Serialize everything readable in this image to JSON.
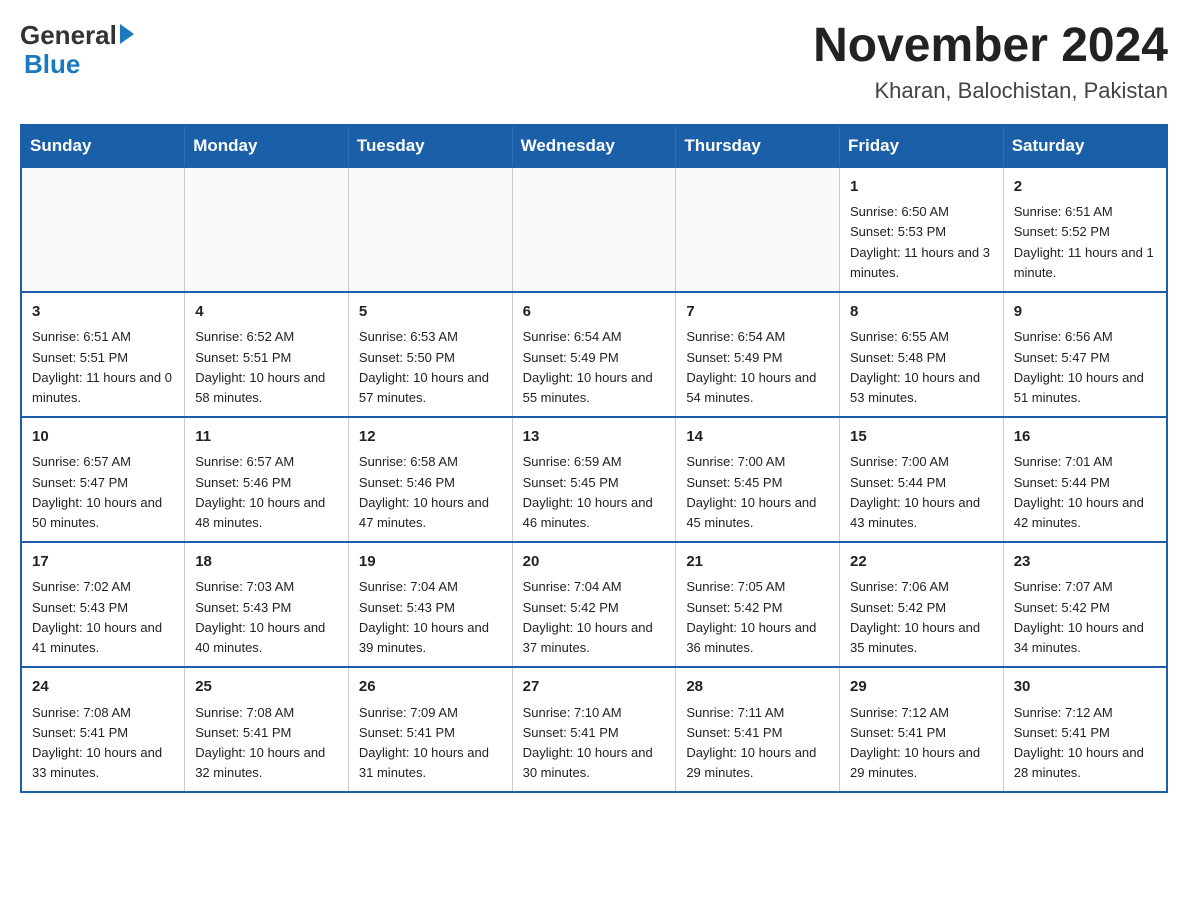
{
  "header": {
    "logo_general": "General",
    "logo_blue": "Blue",
    "main_title": "November 2024",
    "subtitle": "Kharan, Balochistan, Pakistan"
  },
  "days_of_week": [
    "Sunday",
    "Monday",
    "Tuesday",
    "Wednesday",
    "Thursday",
    "Friday",
    "Saturday"
  ],
  "weeks": [
    [
      {
        "day": "",
        "info": ""
      },
      {
        "day": "",
        "info": ""
      },
      {
        "day": "",
        "info": ""
      },
      {
        "day": "",
        "info": ""
      },
      {
        "day": "",
        "info": ""
      },
      {
        "day": "1",
        "info": "Sunrise: 6:50 AM\nSunset: 5:53 PM\nDaylight: 11 hours and 3 minutes."
      },
      {
        "day": "2",
        "info": "Sunrise: 6:51 AM\nSunset: 5:52 PM\nDaylight: 11 hours and 1 minute."
      }
    ],
    [
      {
        "day": "3",
        "info": "Sunrise: 6:51 AM\nSunset: 5:51 PM\nDaylight: 11 hours and 0 minutes."
      },
      {
        "day": "4",
        "info": "Sunrise: 6:52 AM\nSunset: 5:51 PM\nDaylight: 10 hours and 58 minutes."
      },
      {
        "day": "5",
        "info": "Sunrise: 6:53 AM\nSunset: 5:50 PM\nDaylight: 10 hours and 57 minutes."
      },
      {
        "day": "6",
        "info": "Sunrise: 6:54 AM\nSunset: 5:49 PM\nDaylight: 10 hours and 55 minutes."
      },
      {
        "day": "7",
        "info": "Sunrise: 6:54 AM\nSunset: 5:49 PM\nDaylight: 10 hours and 54 minutes."
      },
      {
        "day": "8",
        "info": "Sunrise: 6:55 AM\nSunset: 5:48 PM\nDaylight: 10 hours and 53 minutes."
      },
      {
        "day": "9",
        "info": "Sunrise: 6:56 AM\nSunset: 5:47 PM\nDaylight: 10 hours and 51 minutes."
      }
    ],
    [
      {
        "day": "10",
        "info": "Sunrise: 6:57 AM\nSunset: 5:47 PM\nDaylight: 10 hours and 50 minutes."
      },
      {
        "day": "11",
        "info": "Sunrise: 6:57 AM\nSunset: 5:46 PM\nDaylight: 10 hours and 48 minutes."
      },
      {
        "day": "12",
        "info": "Sunrise: 6:58 AM\nSunset: 5:46 PM\nDaylight: 10 hours and 47 minutes."
      },
      {
        "day": "13",
        "info": "Sunrise: 6:59 AM\nSunset: 5:45 PM\nDaylight: 10 hours and 46 minutes."
      },
      {
        "day": "14",
        "info": "Sunrise: 7:00 AM\nSunset: 5:45 PM\nDaylight: 10 hours and 45 minutes."
      },
      {
        "day": "15",
        "info": "Sunrise: 7:00 AM\nSunset: 5:44 PM\nDaylight: 10 hours and 43 minutes."
      },
      {
        "day": "16",
        "info": "Sunrise: 7:01 AM\nSunset: 5:44 PM\nDaylight: 10 hours and 42 minutes."
      }
    ],
    [
      {
        "day": "17",
        "info": "Sunrise: 7:02 AM\nSunset: 5:43 PM\nDaylight: 10 hours and 41 minutes."
      },
      {
        "day": "18",
        "info": "Sunrise: 7:03 AM\nSunset: 5:43 PM\nDaylight: 10 hours and 40 minutes."
      },
      {
        "day": "19",
        "info": "Sunrise: 7:04 AM\nSunset: 5:43 PM\nDaylight: 10 hours and 39 minutes."
      },
      {
        "day": "20",
        "info": "Sunrise: 7:04 AM\nSunset: 5:42 PM\nDaylight: 10 hours and 37 minutes."
      },
      {
        "day": "21",
        "info": "Sunrise: 7:05 AM\nSunset: 5:42 PM\nDaylight: 10 hours and 36 minutes."
      },
      {
        "day": "22",
        "info": "Sunrise: 7:06 AM\nSunset: 5:42 PM\nDaylight: 10 hours and 35 minutes."
      },
      {
        "day": "23",
        "info": "Sunrise: 7:07 AM\nSunset: 5:42 PM\nDaylight: 10 hours and 34 minutes."
      }
    ],
    [
      {
        "day": "24",
        "info": "Sunrise: 7:08 AM\nSunset: 5:41 PM\nDaylight: 10 hours and 33 minutes."
      },
      {
        "day": "25",
        "info": "Sunrise: 7:08 AM\nSunset: 5:41 PM\nDaylight: 10 hours and 32 minutes."
      },
      {
        "day": "26",
        "info": "Sunrise: 7:09 AM\nSunset: 5:41 PM\nDaylight: 10 hours and 31 minutes."
      },
      {
        "day": "27",
        "info": "Sunrise: 7:10 AM\nSunset: 5:41 PM\nDaylight: 10 hours and 30 minutes."
      },
      {
        "day": "28",
        "info": "Sunrise: 7:11 AM\nSunset: 5:41 PM\nDaylight: 10 hours and 29 minutes."
      },
      {
        "day": "29",
        "info": "Sunrise: 7:12 AM\nSunset: 5:41 PM\nDaylight: 10 hours and 29 minutes."
      },
      {
        "day": "30",
        "info": "Sunrise: 7:12 AM\nSunset: 5:41 PM\nDaylight: 10 hours and 28 minutes."
      }
    ]
  ]
}
